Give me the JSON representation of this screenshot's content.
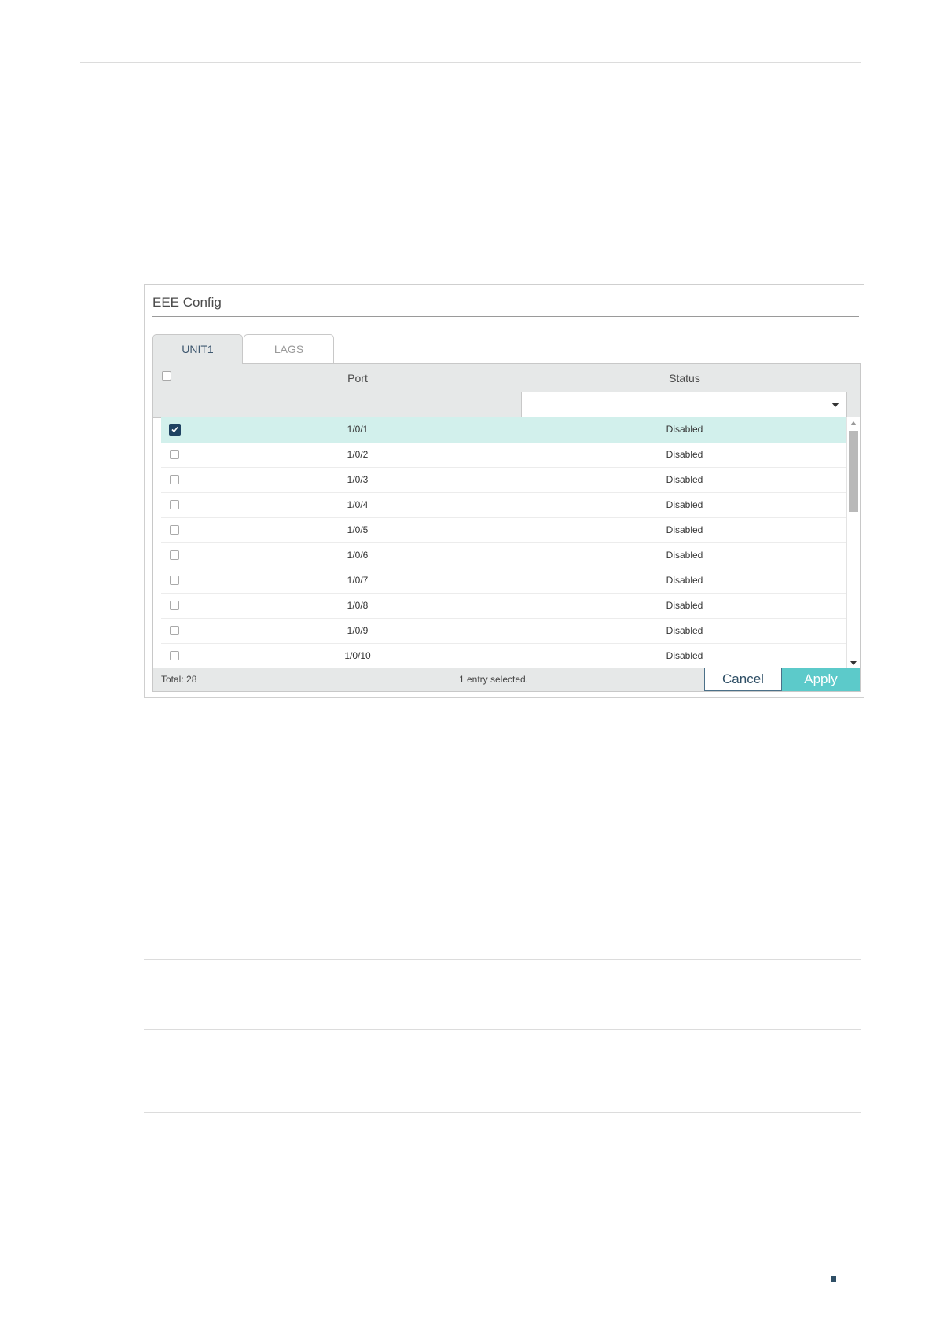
{
  "panel": {
    "title": "EEE Config",
    "tabs": [
      {
        "label": "UNIT1",
        "active": true
      },
      {
        "label": "LAGS",
        "active": false
      }
    ]
  },
  "table": {
    "columns": {
      "port": "Port",
      "status": "Status"
    },
    "status_filter_value": "",
    "rows": [
      {
        "port": "1/0/1",
        "status": "Disabled",
        "checked": true
      },
      {
        "port": "1/0/2",
        "status": "Disabled",
        "checked": false
      },
      {
        "port": "1/0/3",
        "status": "Disabled",
        "checked": false
      },
      {
        "port": "1/0/4",
        "status": "Disabled",
        "checked": false
      },
      {
        "port": "1/0/5",
        "status": "Disabled",
        "checked": false
      },
      {
        "port": "1/0/6",
        "status": "Disabled",
        "checked": false
      },
      {
        "port": "1/0/7",
        "status": "Disabled",
        "checked": false
      },
      {
        "port": "1/0/8",
        "status": "Disabled",
        "checked": false
      },
      {
        "port": "1/0/9",
        "status": "Disabled",
        "checked": false
      },
      {
        "port": "1/0/10",
        "status": "Disabled",
        "checked": false
      }
    ],
    "footer": {
      "total": "Total: 28",
      "selected_info": "1 entry selected.",
      "cancel_label": "Cancel",
      "apply_label": "Apply"
    }
  },
  "colors": {
    "accent": "#5ccaca",
    "selected_row": "#d2f0ec",
    "header_bg": "#e6e8e8",
    "checkbox_checked": "#1f4262"
  },
  "icons": {
    "checkbox_checked": "check-icon",
    "dropdown": "chevron-down-icon",
    "scroll_up": "arrow-up-icon",
    "scroll_down": "arrow-down-icon"
  }
}
